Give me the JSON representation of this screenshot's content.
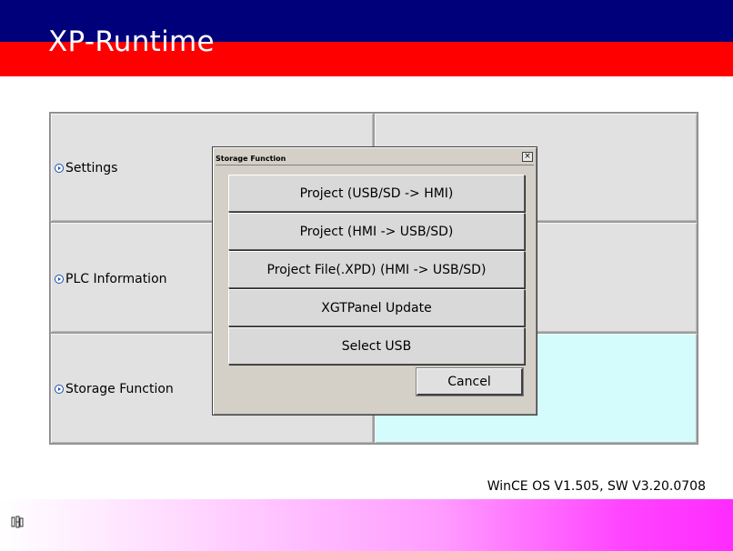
{
  "header": {
    "title": "XP-Runtime",
    "colors": {
      "top": "#00007b",
      "bottom": "#ff0000"
    }
  },
  "menu": {
    "items": [
      {
        "label": "Settings"
      },
      {
        "label": "PLC Information"
      },
      {
        "label": "Storage Function"
      }
    ]
  },
  "dialog": {
    "title": "Storage Function",
    "close_label": "×",
    "options": [
      {
        "label": "Project (USB/SD -> HMI)"
      },
      {
        "label": "Project (HMI -> USB/SD)"
      },
      {
        "label": "Project File(.XPD) (HMI -> USB/SD)"
      },
      {
        "label": "XGTPanel Update"
      },
      {
        "label": "Select USB"
      }
    ],
    "cancel_label": "Cancel"
  },
  "footer": {
    "version": "WinCE OS V1.505, SW V3.20.0708",
    "tray_icon": "keyboard-icon",
    "accent": "#ff2bff"
  }
}
